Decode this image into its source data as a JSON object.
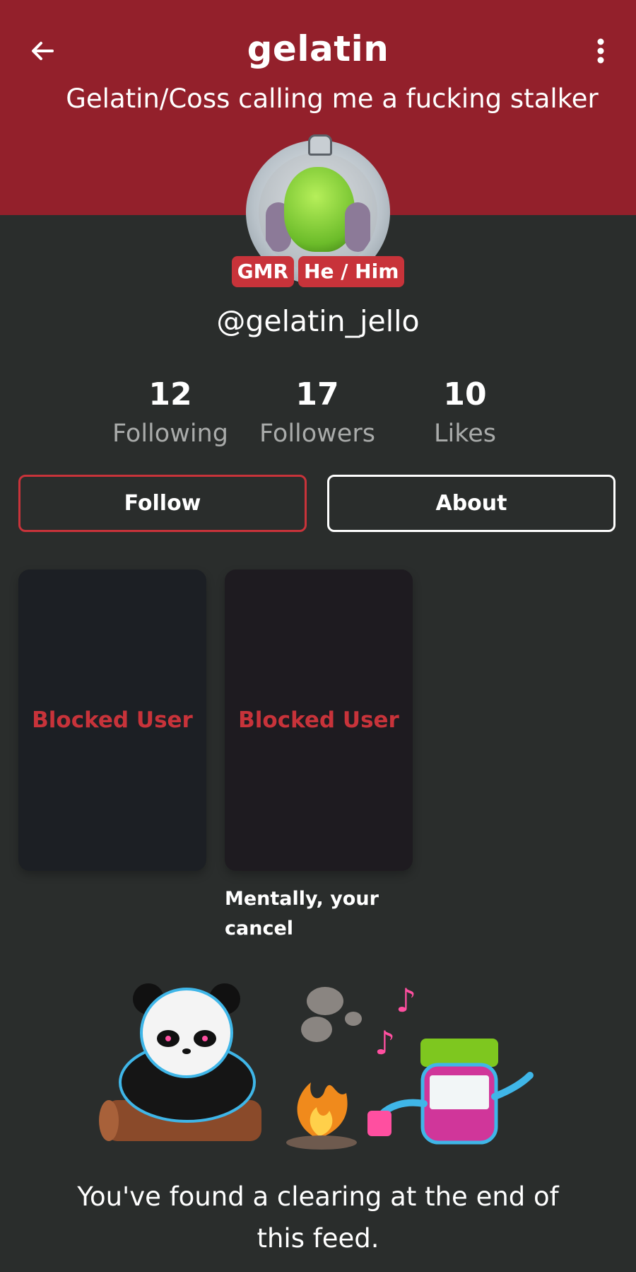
{
  "header": {
    "title": "gelatin",
    "status": "Gelatin/Coss calling me a fucking stalker",
    "back_icon": "arrow-left-icon",
    "menu_icon": "more-vertical-icon",
    "background_color": "#93202b"
  },
  "profile": {
    "badges": [
      "GMR",
      "He / Him"
    ],
    "handle": "@gelatin_jello"
  },
  "stats": [
    {
      "value": "12",
      "label": "Following"
    },
    {
      "value": "17",
      "label": "Followers"
    },
    {
      "value": "10",
      "label": "Likes"
    }
  ],
  "actions": {
    "follow_label": "Follow",
    "about_label": "About"
  },
  "posts": [
    {
      "label": "Blocked User",
      "caption": ""
    },
    {
      "label": "Blocked User",
      "caption": "Mentally, your cancel"
    }
  ],
  "end_of_feed": {
    "message": "You've found a clearing at the end of this feed."
  },
  "colors": {
    "accent": "#c8333a",
    "background": "#2a2d2c"
  }
}
